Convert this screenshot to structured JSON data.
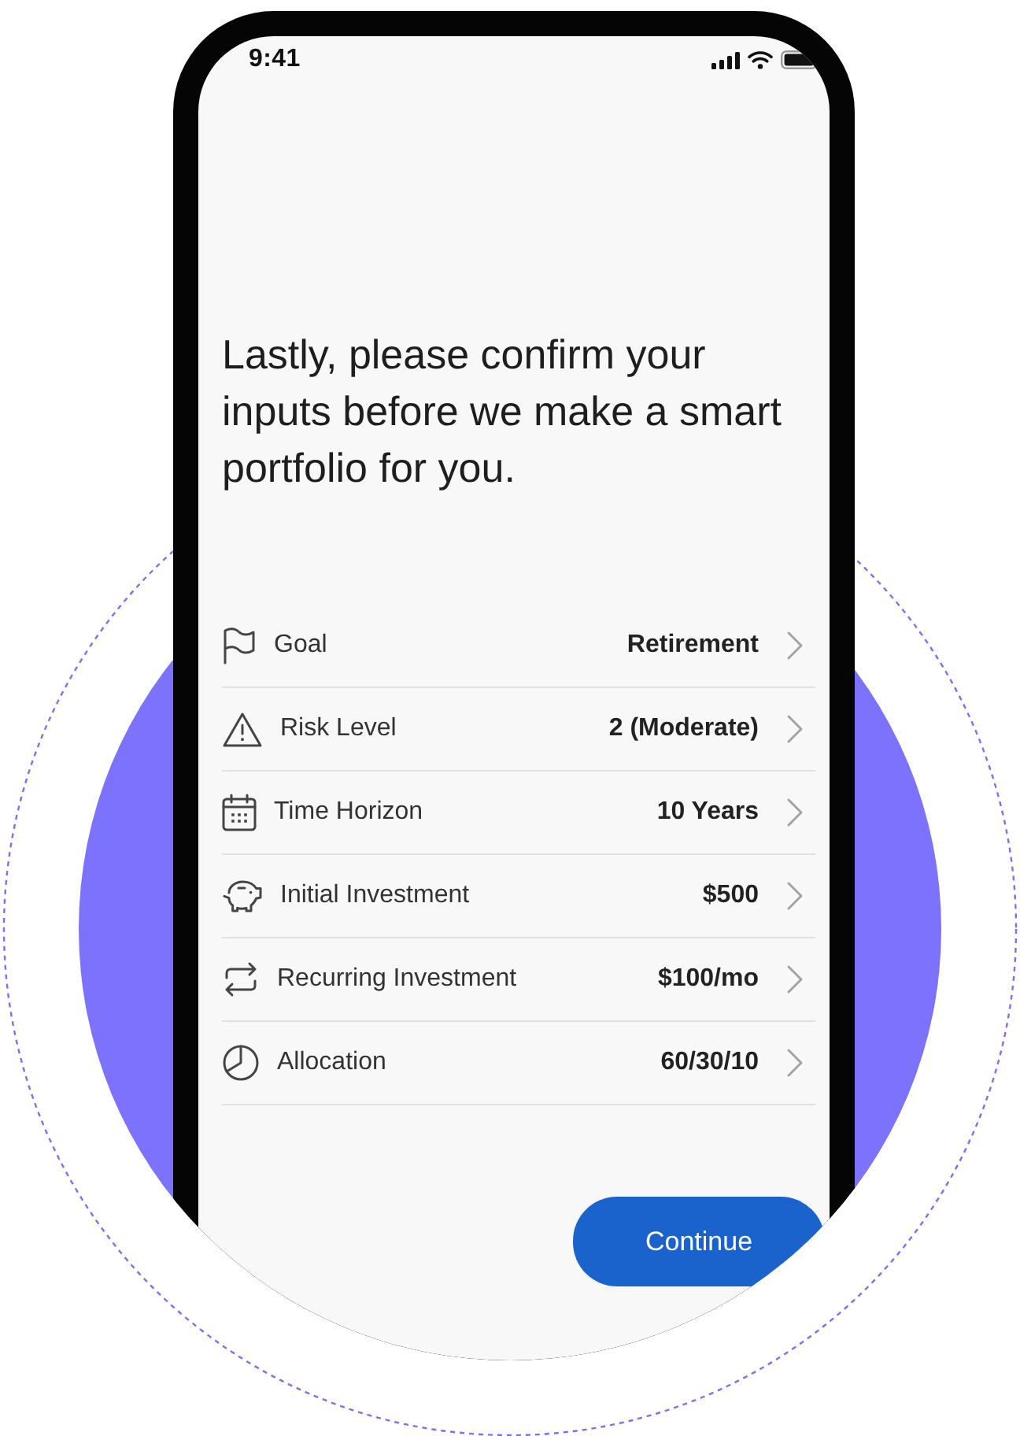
{
  "status_bar": {
    "time": "9:41"
  },
  "heading": "Lastly, please confirm your inputs before we make a smart portfolio for you.",
  "summary_rows": [
    {
      "label": "Goal",
      "value": "Retirement"
    },
    {
      "label": "Risk Level",
      "value": "2 (Moderate)"
    },
    {
      "label": "Time Horizon",
      "value": "10 Years"
    },
    {
      "label": "Initial Investment",
      "value": "$500"
    },
    {
      "label": "Recurring Investment",
      "value": "$100/mo"
    },
    {
      "label": "Allocation",
      "value": "60/30/10"
    }
  ],
  "primary_button": {
    "label": "Continue"
  }
}
